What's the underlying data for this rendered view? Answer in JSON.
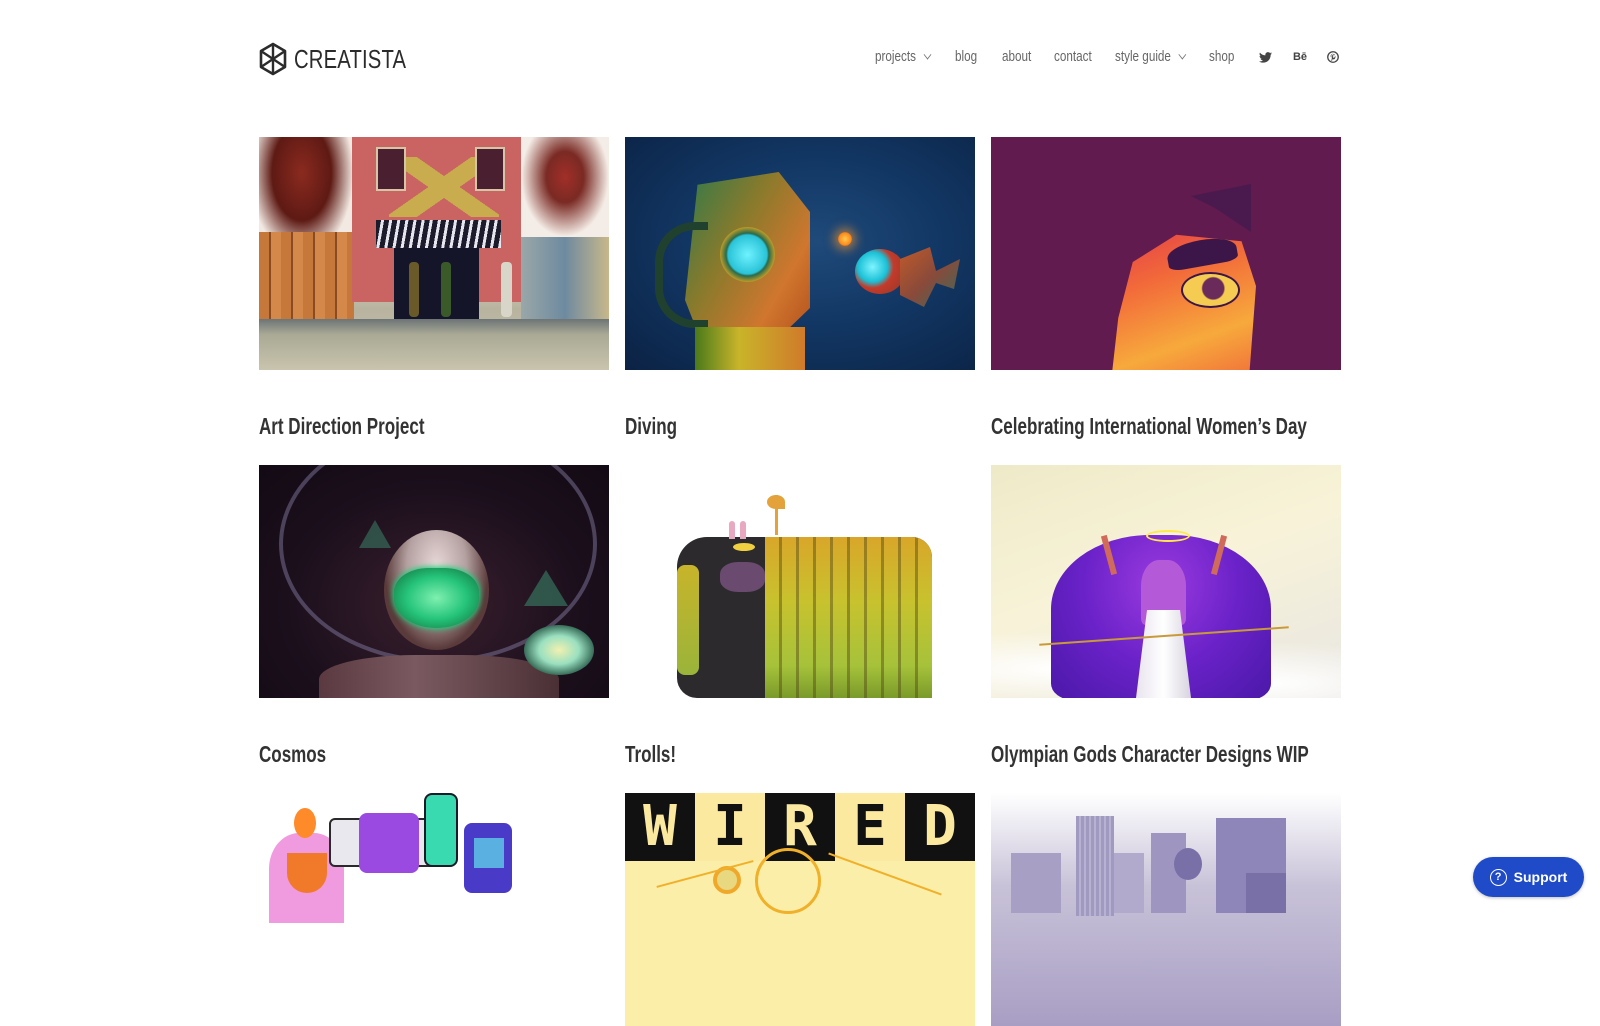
{
  "brand": {
    "name": "CREATISTA",
    "icon": "hexagon-logo-icon"
  },
  "nav": {
    "items": [
      {
        "label": "projects",
        "has_dropdown": true
      },
      {
        "label": "blog",
        "has_dropdown": false
      },
      {
        "label": "about",
        "has_dropdown": false
      },
      {
        "label": "contact",
        "has_dropdown": false
      },
      {
        "label": "style guide",
        "has_dropdown": true
      },
      {
        "label": "shop",
        "has_dropdown": false
      }
    ],
    "social": [
      {
        "name": "twitter",
        "icon": "twitter-icon"
      },
      {
        "name": "behance",
        "icon": "behance-icon",
        "glyph": "Bē"
      },
      {
        "name": "pinterest",
        "icon": "pinterest-icon"
      }
    ]
  },
  "projects": [
    {
      "title": "Art Direction Project",
      "artwork": "street-scene"
    },
    {
      "title": "Diving",
      "artwork": "diver-anglerfish"
    },
    {
      "title": "Celebrating International Women’s Day",
      "artwork": "woman-eye"
    },
    {
      "title": "Cosmos",
      "artwork": "astronaut"
    },
    {
      "title": "Trolls!",
      "artwork": "troll"
    },
    {
      "title": "Olympian Gods Character Designs WIP",
      "artwork": "goddess"
    },
    {
      "title": "",
      "artwork": "monster-band"
    },
    {
      "title": "",
      "artwork": "wired"
    },
    {
      "title": "",
      "artwork": "city-skyline"
    }
  ],
  "wired_letters": [
    "W",
    "I",
    "R",
    "E",
    "D"
  ],
  "support": {
    "label": "Support",
    "icon": "question-circle-icon",
    "color": "#1f4bc8"
  }
}
